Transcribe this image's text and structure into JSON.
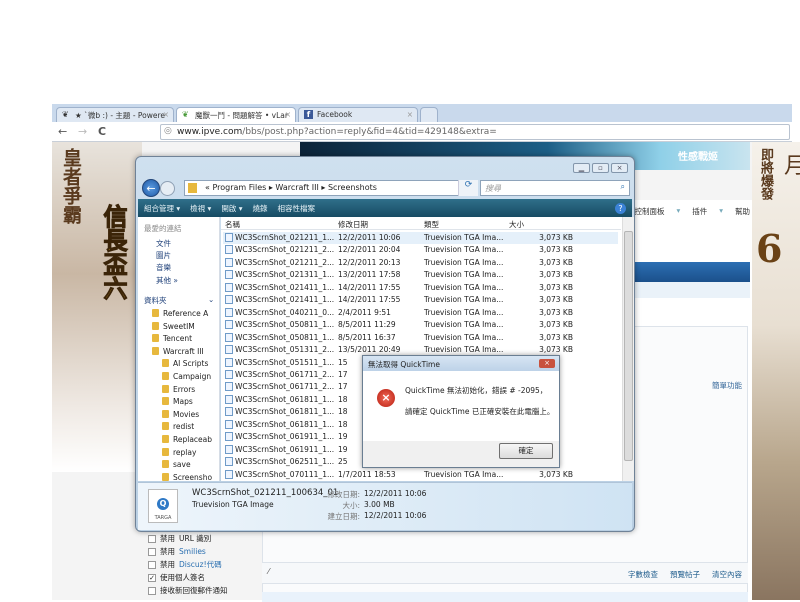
{
  "browser": {
    "tabs": [
      {
        "label": "★ `微b :) - 主題 - Powere",
        "icon": "vlan-icon"
      },
      {
        "label": "魔獸一鬥 - 問題解答 • vLar",
        "icon": "vlan-icon",
        "active": true
      },
      {
        "label": "Facebook",
        "icon": "facebook-icon"
      }
    ],
    "url_host": "www.ipve.com",
    "url_path": "/bbs/post.php?action=reply&fid=4&tid=429148&extra="
  },
  "banners": {
    "left_title": "皇者爭霸",
    "left_game": "信長盃六",
    "right_text": "即將爆發",
    "right_number": "6",
    "right_partial": "月",
    "ad_text": "性感戰姬"
  },
  "forum": {
    "menu": [
      "控制面板",
      "插件",
      "幫助"
    ],
    "simple_mode": "簡單功能",
    "editor_buttons": [
      "字數檢查",
      "預覽帖子",
      "清空內容"
    ],
    "options": [
      {
        "label": "禁用 ",
        "link": "URL 識別",
        "checked": false
      },
      {
        "label": "禁用 ",
        "link": "Smilies",
        "checked": false
      },
      {
        "label": "禁用 ",
        "link": "Discuz!代碼",
        "checked": false
      },
      {
        "label": "使用個人簽名",
        "link": "",
        "checked": true
      },
      {
        "label": "接收新回復郵件通知",
        "link": "",
        "checked": false
      }
    ]
  },
  "explorer": {
    "breadcrumb": [
      "«",
      "Program Files",
      "Warcraft III",
      "Screenshots"
    ],
    "search_placeholder": "搜尋",
    "toolbar": [
      "組合管理 ▾",
      "檢視 ▾",
      "開啟 ▾",
      "燒錄",
      "相容性檔案"
    ],
    "favorites_header": "最愛的連結",
    "favorites": [
      "文件",
      "圖片",
      "音樂",
      "其他 »"
    ],
    "folders_header": "資料夾",
    "folders": [
      "Reference A",
      "SweetIM",
      "Tencent",
      "Warcraft III",
      "AI Scripts",
      "Campaign",
      "Errors",
      "Maps",
      "Movies",
      "redist",
      "Replaceab",
      "replay",
      "save",
      "Screensho"
    ],
    "columns": [
      "名稱",
      "修改日期",
      "類型",
      "大小"
    ],
    "files": [
      {
        "name": "WC3ScrnShot_021211_1...",
        "date": "12/2/2011 10:06",
        "type": "Truevision TGA Ima...",
        "size": "3,073 KB"
      },
      {
        "name": "WC3ScrnShot_021211_2...",
        "date": "12/2/2011 20:04",
        "type": "Truevision TGA Ima...",
        "size": "3,073 KB"
      },
      {
        "name": "WC3ScrnShot_021211_2...",
        "date": "12/2/2011 20:13",
        "type": "Truevision TGA Ima...",
        "size": "3,073 KB"
      },
      {
        "name": "WC3ScrnShot_021311_1...",
        "date": "13/2/2011 17:58",
        "type": "Truevision TGA Ima...",
        "size": "3,073 KB"
      },
      {
        "name": "WC3ScrnShot_021411_1...",
        "date": "14/2/2011 17:55",
        "type": "Truevision TGA Ima...",
        "size": "3,073 KB"
      },
      {
        "name": "WC3ScrnShot_021411_1...",
        "date": "14/2/2011 17:55",
        "type": "Truevision TGA Ima...",
        "size": "3,073 KB"
      },
      {
        "name": "WC3ScrnShot_040211_0...",
        "date": "2/4/2011 9:51",
        "type": "Truevision TGA Ima...",
        "size": "3,073 KB"
      },
      {
        "name": "WC3ScrnShot_050811_1...",
        "date": "8/5/2011 11:29",
        "type": "Truevision TGA Ima...",
        "size": "3,073 KB"
      },
      {
        "name": "WC3ScrnShot_050811_1...",
        "date": "8/5/2011 16:37",
        "type": "Truevision TGA Ima...",
        "size": "3,073 KB"
      },
      {
        "name": "WC3ScrnShot_051311_2...",
        "date": "13/5/2011 20:49",
        "type": "Truevision TGA Ima...",
        "size": "3,073 KB"
      },
      {
        "name": "WC3ScrnShot_051511_1...",
        "date": "15",
        "type": "",
        "size": ""
      },
      {
        "name": "WC3ScrnShot_061711_2...",
        "date": "17",
        "type": "",
        "size": ""
      },
      {
        "name": "WC3ScrnShot_061711_2...",
        "date": "17",
        "type": "",
        "size": ""
      },
      {
        "name": "WC3ScrnShot_061811_1...",
        "date": "18",
        "type": "",
        "size": ""
      },
      {
        "name": "WC3ScrnShot_061811_1...",
        "date": "18",
        "type": "",
        "size": ""
      },
      {
        "name": "WC3ScrnShot_061811_1...",
        "date": "18",
        "type": "",
        "size": ""
      },
      {
        "name": "WC3ScrnShot_061911_1...",
        "date": "19",
        "type": "",
        "size": ""
      },
      {
        "name": "WC3ScrnShot_061911_1...",
        "date": "19",
        "type": "",
        "size": ""
      },
      {
        "name": "WC3ScrnShot_062511_1...",
        "date": "25",
        "type": "",
        "size": ""
      },
      {
        "name": "WC3ScrnShot_070111_1...",
        "date": "1/7/2011 18:53",
        "type": "Truevision TGA Ima...",
        "size": "3,073 KB"
      }
    ],
    "details": {
      "filename": "WC3ScrnShot_021211_100634_01",
      "filetype": "Truevision TGA Image",
      "thumb_label": "TARGA",
      "modified_label": "修改日期:",
      "modified": "12/2/2011 10:06",
      "size_label": "大小:",
      "size": "3.00 MB",
      "created_label": "建立日期:",
      "created": "12/2/2011 10:06"
    }
  },
  "dialog": {
    "title": "無法取得 QuickTime",
    "line1": "QuickTime 無法初始化，錯誤 # -2095，",
    "line2": "請確定 QuickTime 已正確安裝在此電腦上。",
    "ok": "確定"
  }
}
